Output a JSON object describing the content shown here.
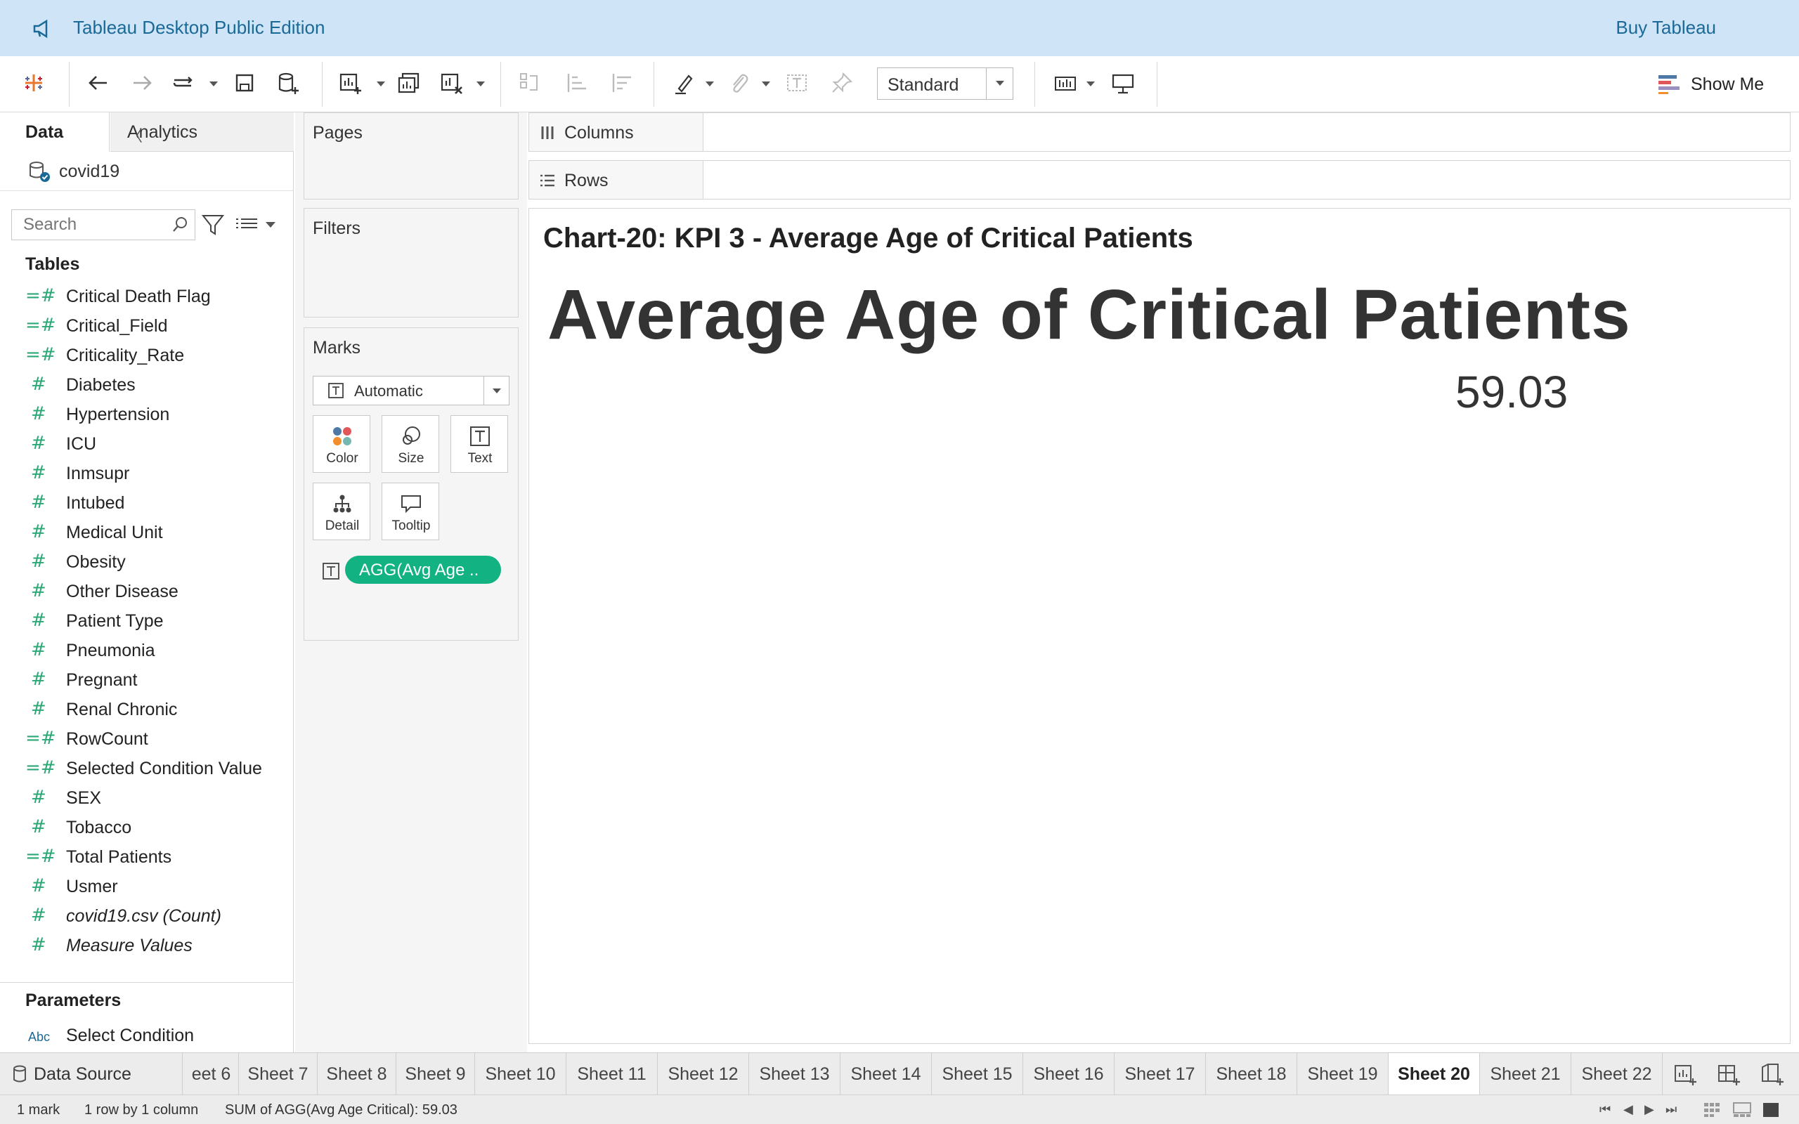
{
  "banner": {
    "title": "Tableau Desktop Public Edition",
    "buy": "Buy Tableau"
  },
  "toolbar": {
    "view_size": "Standard",
    "show_me": "Show Me"
  },
  "data_pane": {
    "tab_data": "Data",
    "tab_analytics": "Analytics",
    "datasource": "covid19",
    "search_placeholder": "Search",
    "tables_heading": "Tables",
    "fields": [
      {
        "name": "Critical Death Flag",
        "type": "calc-measure"
      },
      {
        "name": "Critical_Field",
        "type": "calc-measure"
      },
      {
        "name": "Criticality_Rate",
        "type": "calc-measure"
      },
      {
        "name": "Diabetes",
        "type": "measure"
      },
      {
        "name": "Hypertension",
        "type": "measure"
      },
      {
        "name": "ICU",
        "type": "measure"
      },
      {
        "name": "Inmsupr",
        "type": "measure"
      },
      {
        "name": "Intubed",
        "type": "measure"
      },
      {
        "name": "Medical Unit",
        "type": "measure"
      },
      {
        "name": "Obesity",
        "type": "measure"
      },
      {
        "name": "Other Disease",
        "type": "measure"
      },
      {
        "name": "Patient Type",
        "type": "measure"
      },
      {
        "name": "Pneumonia",
        "type": "measure"
      },
      {
        "name": "Pregnant",
        "type": "measure"
      },
      {
        "name": "Renal Chronic",
        "type": "measure"
      },
      {
        "name": "RowCount",
        "type": "calc-measure"
      },
      {
        "name": "Selected Condition Value",
        "type": "calc-measure"
      },
      {
        "name": "SEX",
        "type": "measure"
      },
      {
        "name": "Tobacco",
        "type": "measure"
      },
      {
        "name": "Total Patients",
        "type": "calc-measure"
      },
      {
        "name": "Usmer",
        "type": "measure"
      },
      {
        "name": "covid19.csv (Count)",
        "type": "measure",
        "italic": true
      },
      {
        "name": "Measure Values",
        "type": "measure",
        "italic": true
      }
    ],
    "parameters_heading": "Parameters",
    "parameter": {
      "type": "Abc",
      "name": "Select Condition"
    }
  },
  "cards": {
    "pages": "Pages",
    "filters": "Filters",
    "marks": "Marks",
    "mark_type": "Automatic",
    "buttons": {
      "color": "Color",
      "size": "Size",
      "text": "Text",
      "detail": "Detail",
      "tooltip": "Tooltip"
    },
    "pill": "AGG(Avg Age .."
  },
  "shelves": {
    "columns": "Columns",
    "rows": "Rows"
  },
  "view": {
    "sheet_title": "Chart-20: KPI 3 - Average Age of Critical Patients",
    "kpi_label": "Average Age of Critical Patients",
    "kpi_value": "59.03"
  },
  "sheet_tabs": {
    "data_source": "Data Source",
    "tabs": [
      "eet 6",
      "Sheet 7",
      "Sheet 8",
      "Sheet 9",
      "Sheet 10",
      "Sheet 11",
      "Sheet 12",
      "Sheet 13",
      "Sheet 14",
      "Sheet 15",
      "Sheet 16",
      "Sheet 17",
      "Sheet 18",
      "Sheet 19",
      "Sheet 20",
      "Sheet 21",
      "Sheet 22"
    ],
    "active": "Sheet 20"
  },
  "status": {
    "marks": "1 mark",
    "dims": "1 row by 1 column",
    "sum": "SUM of AGG(Avg Age Critical): 59.03"
  },
  "colors": {
    "banner": "#cfe4f7",
    "accent_green": "#13b283",
    "link_blue": "#1a6a97"
  }
}
